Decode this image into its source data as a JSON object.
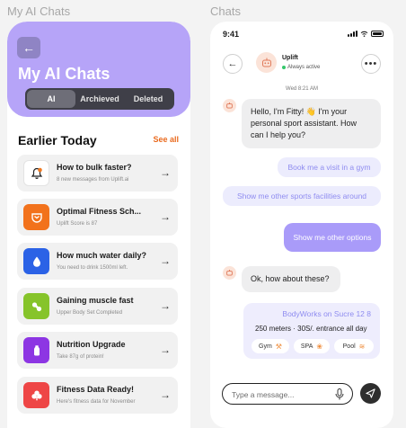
{
  "captions": {
    "left": "My AI Chats",
    "right": "Chats"
  },
  "left": {
    "title": "My AI Chats",
    "tabs": [
      {
        "label": "AI",
        "active": true
      },
      {
        "label": "Archieved"
      },
      {
        "label": "Deleted"
      }
    ],
    "section_title": "Earlier Today",
    "see_all": "See all",
    "chats": [
      {
        "title": "How to bulk faster?",
        "subtitle": "8 new messages from Uplift.ai",
        "icon": "bell-icon",
        "color": "#ffffff"
      },
      {
        "title": "Optimal Fitness Sch...",
        "subtitle": "Uplift Score is 87",
        "icon": "shield-icon",
        "color": "#f2721c"
      },
      {
        "title": "How much water daily?",
        "subtitle": "You need to drink 1500ml left.",
        "icon": "water-drop-icon",
        "color": "#2b62e6"
      },
      {
        "title": "Gaining muscle fast",
        "subtitle": "Upper Body Set Completed",
        "icon": "pills-icon",
        "color": "#86c42a"
      },
      {
        "title": "Nutrition Upgrade",
        "subtitle": "Take 87g of protein!",
        "icon": "bottle-icon",
        "color": "#8d36e3"
      },
      {
        "title": "Fitness Data Ready!",
        "subtitle": "Here's fitness data for November",
        "icon": "clover-icon",
        "color": "#ee4646"
      }
    ],
    "colors": {
      "header": "#b6a4f8",
      "accent": "#ea6b1f"
    }
  },
  "right": {
    "status": {
      "time": "9:41"
    },
    "bot": {
      "name": "Uplift",
      "status": "Always active"
    },
    "date_separator": "Wed 8:21 AM",
    "messages": {
      "greeting": "Hello, I'm Fitty! 👋 I'm your personal sport assistant. How can I help you?",
      "suggestion_1": "Book me a visit in a gym",
      "suggestion_2": "Show me other sports facilities around",
      "user_message": "Show me other options",
      "reply": "Ok, how about these?"
    },
    "venue": {
      "name": "BodyWorks on Sucre 12 8",
      "info": "250 meters  ·  30S/. entrance all day",
      "amenities": [
        {
          "label": "Gym",
          "icon": "dumbbell-icon"
        },
        {
          "label": "SPA",
          "icon": "spa-icon"
        },
        {
          "label": "Pool",
          "icon": "pool-icon"
        }
      ]
    },
    "input": {
      "placeholder": "Type a message..."
    },
    "colors": {
      "user_bubble": "#a99bf9",
      "suggestion_text": "#8f8cf0"
    }
  }
}
